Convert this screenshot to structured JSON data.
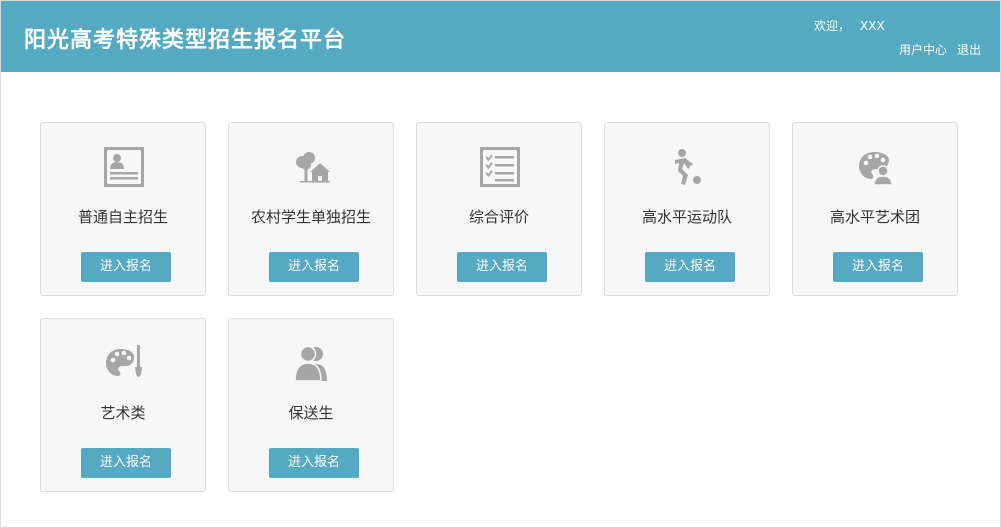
{
  "header": {
    "title": "阳光高考特殊类型招生报名平台",
    "welcome_label": "欢迎，",
    "username": "XXX",
    "user_center": "用户中心",
    "logout": "退出",
    "background_color": "#55a9c2"
  },
  "cards": [
    {
      "label": "普通自主招生",
      "button": "进入报名",
      "icon": "id-card-icon"
    },
    {
      "label": "农村学生单独招生",
      "button": "进入报名",
      "icon": "rural-house-tree-icon"
    },
    {
      "label": "综合评价",
      "button": "进入报名",
      "icon": "checklist-icon"
    },
    {
      "label": "高水平运动队",
      "button": "进入报名",
      "icon": "soccer-player-icon"
    },
    {
      "label": "高水平艺术团",
      "button": "进入报名",
      "icon": "palette-person-icon"
    },
    {
      "label": "艺术类",
      "button": "进入报名",
      "icon": "palette-brush-icon"
    },
    {
      "label": "保送生",
      "button": "进入报名",
      "icon": "users-icon"
    }
  ],
  "colors": {
    "accent": "#55a9c2",
    "card_background": "#f7f7f7",
    "icon_gray": "#a6a6a6"
  }
}
